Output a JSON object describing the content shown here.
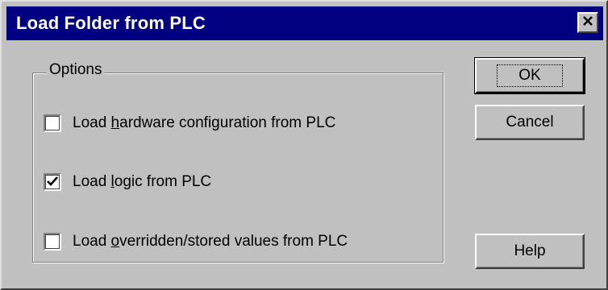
{
  "window": {
    "title": "Load Folder from PLC"
  },
  "options": {
    "legend": "Options",
    "items": [
      {
        "before": "Load ",
        "mnemonic": "h",
        "after": "ardware configuration from PLC",
        "checked": false
      },
      {
        "before": "Load ",
        "mnemonic": "l",
        "after": "ogic from PLC",
        "checked": true
      },
      {
        "before": "Load ",
        "mnemonic": "o",
        "after": "verridden/stored values from PLC",
        "checked": false
      }
    ]
  },
  "buttons": {
    "ok": "OK",
    "cancel": "Cancel",
    "help": "Help"
  },
  "icons": {
    "close": "close-icon",
    "check": "checkmark-icon"
  },
  "colors": {
    "titlebar": "#000080",
    "face": "#c0c0c0",
    "title_text": "#ffffff"
  }
}
